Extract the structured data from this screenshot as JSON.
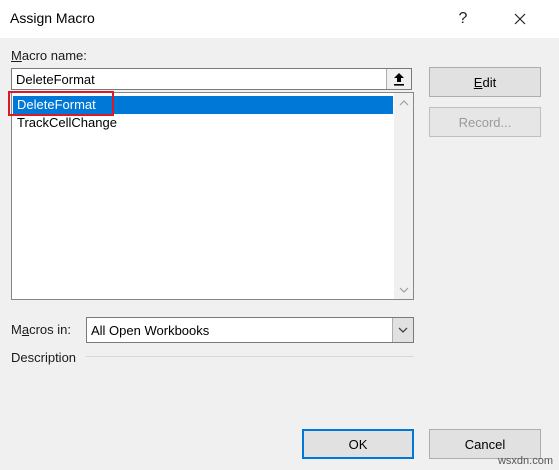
{
  "window": {
    "title": "Assign Macro",
    "help_glyph": "?",
    "close_glyph": "✕"
  },
  "macro_name": {
    "label_accel": "M",
    "label_rest": "acro name:",
    "value": "DeleteFormat"
  },
  "macro_list": {
    "items": [
      "DeleteFormat",
      "TrackCellChange"
    ],
    "selected_index": 0
  },
  "buttons": {
    "edit_accel": "E",
    "edit_rest": "dit",
    "record": "Record...",
    "ok": "OK",
    "cancel": "Cancel"
  },
  "macros_in": {
    "label_pre": "M",
    "label_accel": "a",
    "label_rest": "cros in:",
    "value": "All Open Workbooks"
  },
  "description": {
    "label": "Description"
  },
  "watermark": "wsxdn.com",
  "colors": {
    "selection": "#0078d7",
    "highlight_box": "#d81b24"
  }
}
